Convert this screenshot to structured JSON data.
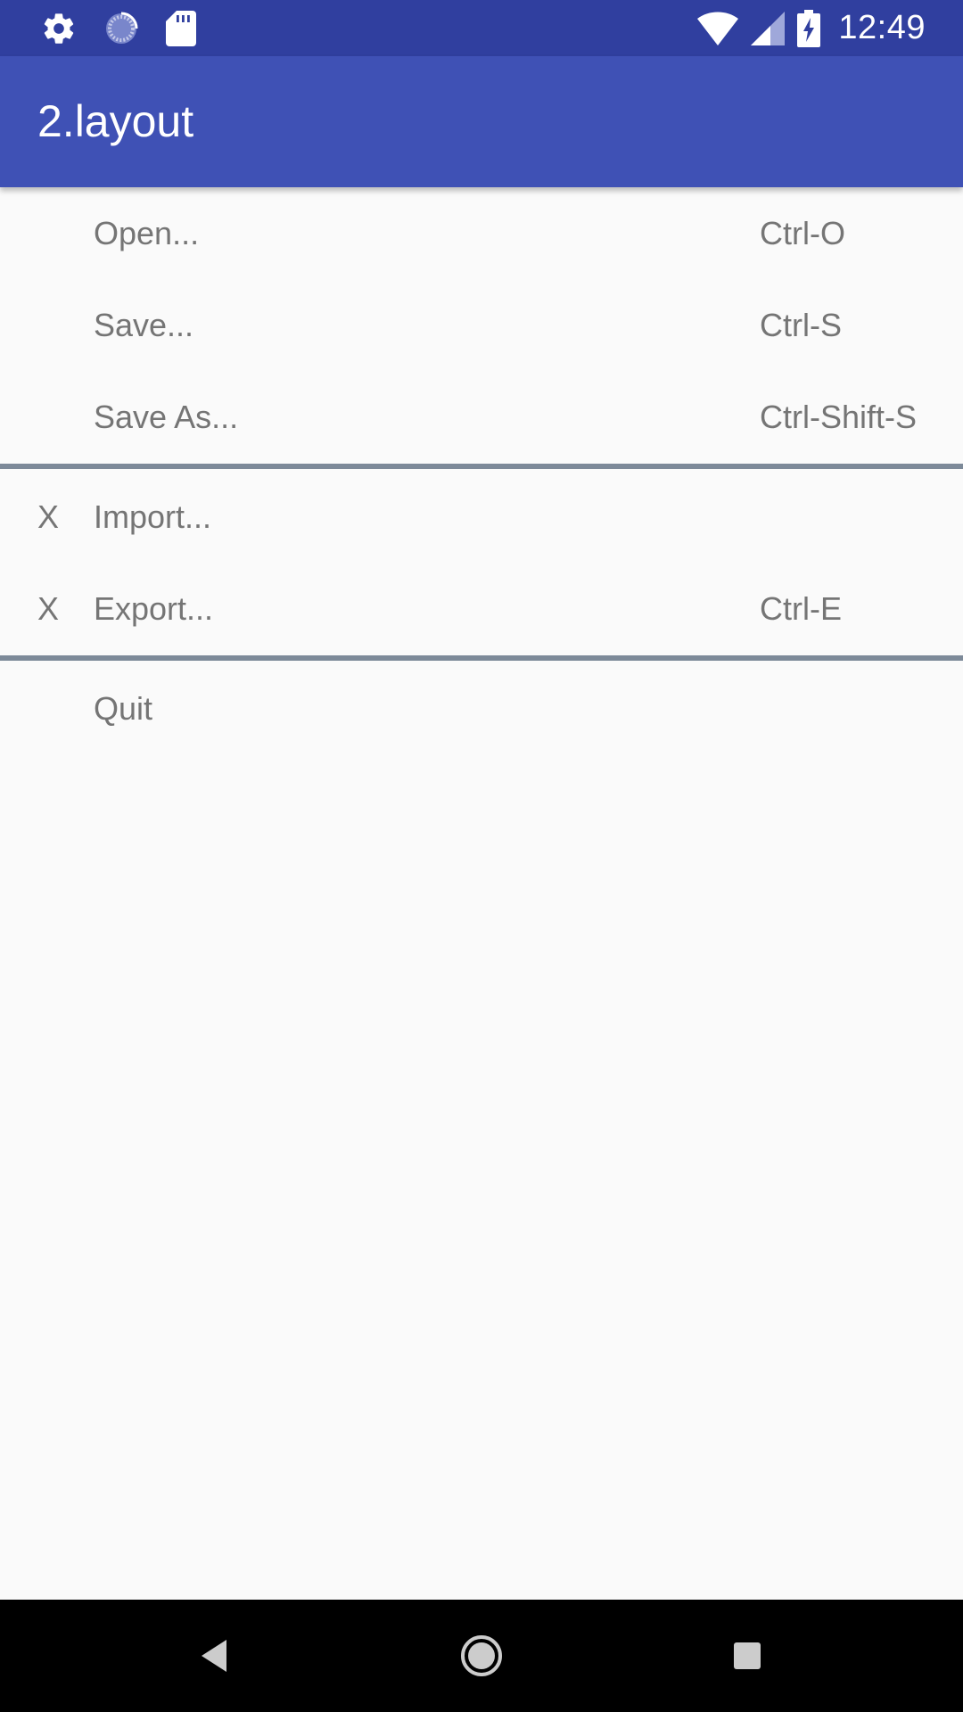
{
  "status_bar": {
    "time": "12:49",
    "left_icons": [
      "settings-icon",
      "loading-circle-icon",
      "sd-card-icon"
    ],
    "right_icons": [
      "wifi-icon",
      "cell-signal-icon",
      "battery-charging-icon"
    ]
  },
  "app_bar": {
    "title": "2.layout"
  },
  "menu": {
    "groups": [
      {
        "items": [
          {
            "check": "",
            "label": "Open...",
            "shortcut": "Ctrl-O"
          },
          {
            "check": "",
            "label": "Save...",
            "shortcut": "Ctrl-S"
          },
          {
            "check": "",
            "label": "Save As...",
            "shortcut": "Ctrl-Shift-S"
          }
        ]
      },
      {
        "items": [
          {
            "check": "X",
            "label": "Import...",
            "shortcut": ""
          },
          {
            "check": "X",
            "label": "Export...",
            "shortcut": "Ctrl-E"
          }
        ]
      },
      {
        "items": [
          {
            "check": "",
            "label": "Quit",
            "shortcut": ""
          }
        ]
      }
    ]
  },
  "nav_bar": {
    "buttons": [
      "back-icon",
      "home-icon",
      "recent-apps-icon"
    ]
  },
  "colors": {
    "status_bar": "#303f9f",
    "app_bar": "#3f51b5",
    "background": "#fafafa",
    "menu_text": "#757575",
    "divider": "#7d8a99",
    "nav_bar": "#000000"
  }
}
